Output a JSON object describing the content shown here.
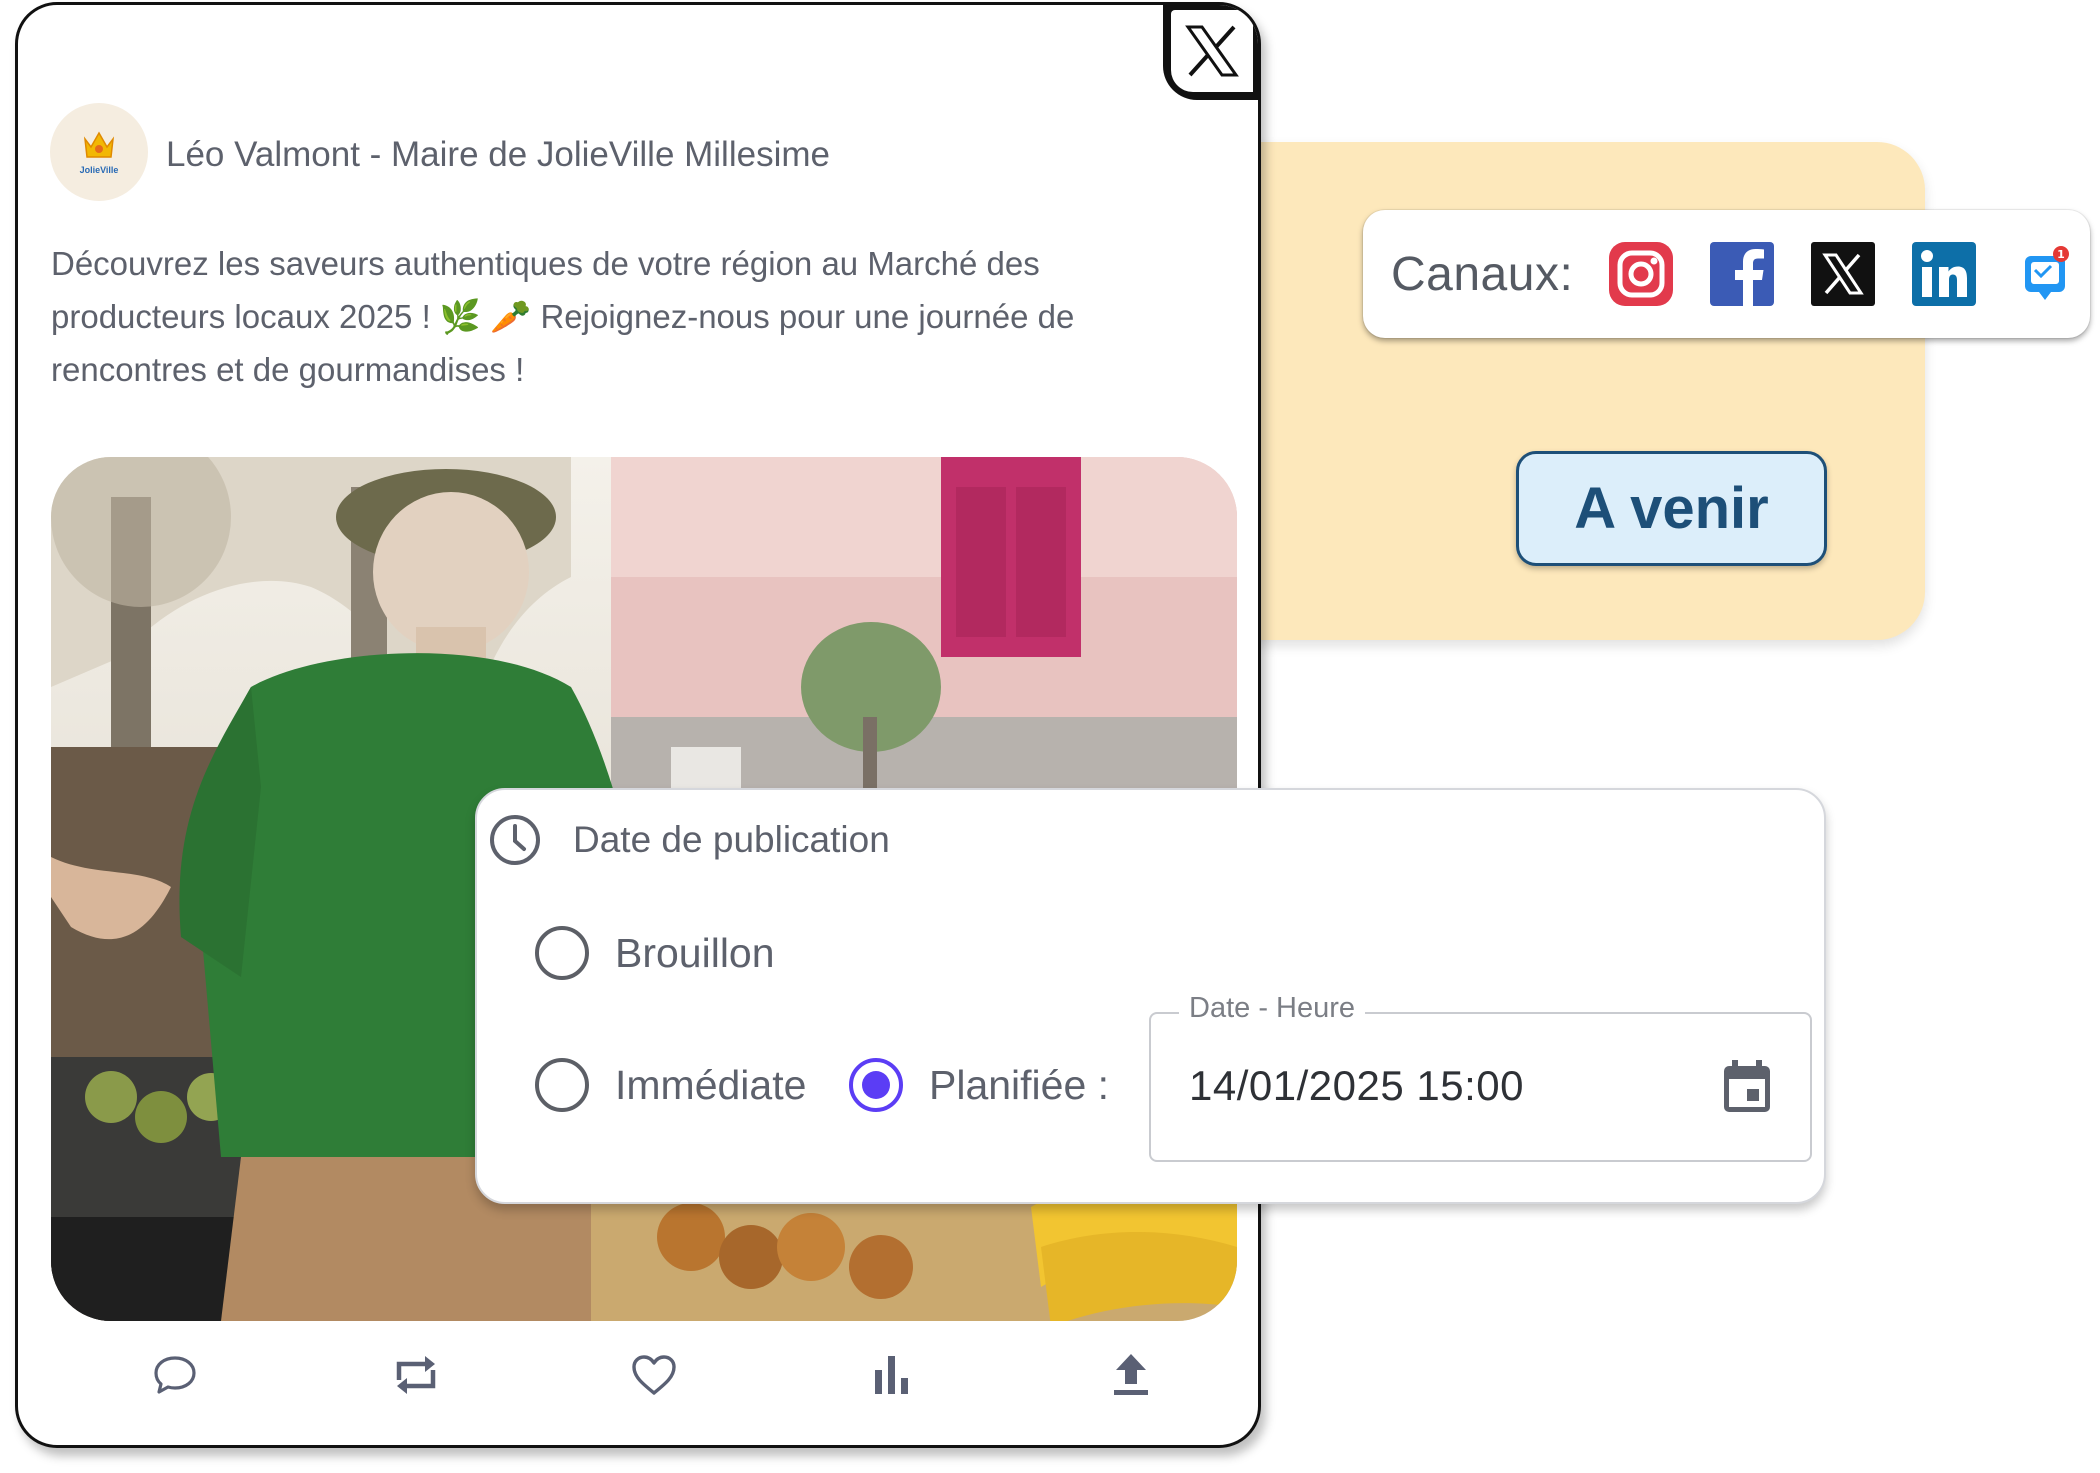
{
  "post": {
    "author": "Léo Valmont - Maire de JolieVille Millesime",
    "avatar_logo_text": "JolieVille",
    "text_part1": "Découvrez les saveurs authentiques de votre région au Marché des producteurs locaux 2025 ! ",
    "emoji1": "🌿",
    "emoji2": "🥕",
    "text_part2": " Rejoignez-nous pour une journée de rencontres et de gourmandises !",
    "platform_icon": "x-logo-icon",
    "actions": [
      "comment-icon",
      "repost-icon",
      "like-icon",
      "stats-icon",
      "share-icon"
    ]
  },
  "channels": {
    "label": "Canaux:",
    "items": [
      "instagram-icon",
      "facebook-icon",
      "x-icon",
      "linkedin-icon",
      "google-business-icon"
    ],
    "badge_count": "1"
  },
  "status": {
    "label": "A venir",
    "color": "#1d4f78"
  },
  "publication": {
    "title": "Date de publication",
    "options": {
      "draft": "Brouillon",
      "immediate": "Immédiate",
      "scheduled": "Planifiée :"
    },
    "selected": "scheduled",
    "datetime_legend": "Date - Heure",
    "datetime_value": "14/01/2025 15:00"
  },
  "colors": {
    "accent": "#5b3df5",
    "card_background": "#fde8bb",
    "text": "#5d616c"
  }
}
